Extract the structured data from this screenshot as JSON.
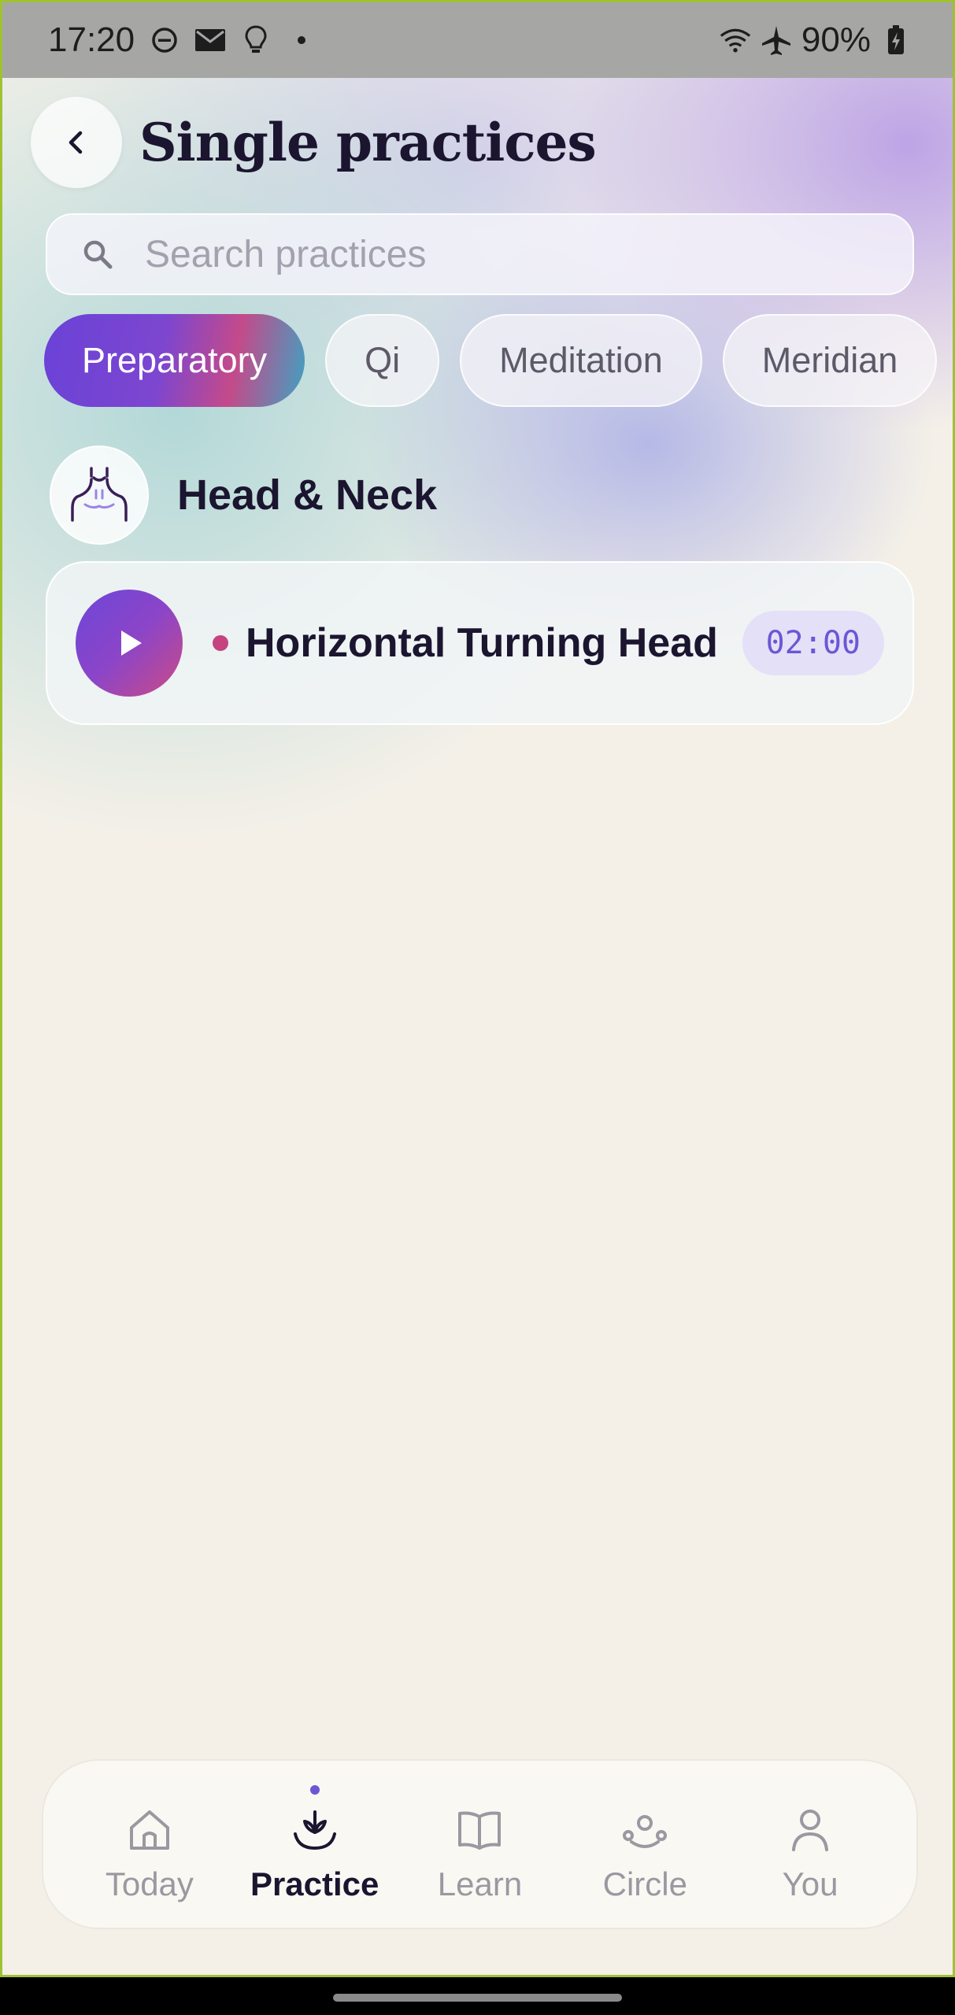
{
  "status_bar": {
    "time": "17:20",
    "battery": "90%",
    "left_icons": [
      "do-not-disturb-icon",
      "mail-icon",
      "lightbulb-icon",
      "dot-icon"
    ],
    "right_icons": [
      "wifi-icon",
      "airplane-icon",
      "battery-charging-icon"
    ]
  },
  "header": {
    "title": "Single practices",
    "back_icon": "chevron-left-icon"
  },
  "search": {
    "placeholder": "Search practices",
    "value": ""
  },
  "filters": [
    {
      "label": "Preparatory",
      "active": true
    },
    {
      "label": "Qi",
      "active": false
    },
    {
      "label": "Meditation",
      "active": false
    },
    {
      "label": "Meridian",
      "active": false
    }
  ],
  "section": {
    "title": "Head & Neck",
    "icon": "neck-body-icon"
  },
  "practices": [
    {
      "name": "Horizontal Turning Head",
      "duration": "02:00"
    }
  ],
  "bottom_nav": {
    "items": [
      {
        "label": "Today",
        "icon": "home-icon",
        "active": false
      },
      {
        "label": "Practice",
        "icon": "lotus-icon",
        "active": true
      },
      {
        "label": "Learn",
        "icon": "book-icon",
        "active": false
      },
      {
        "label": "Circle",
        "icon": "people-icon",
        "active": false
      },
      {
        "label": "You",
        "icon": "user-icon",
        "active": false
      }
    ]
  },
  "colors": {
    "accent": "#6b57d6",
    "active_chip_gradient": [
      "#6a42d8",
      "#c44a8a",
      "#3fa2c2"
    ],
    "dot": "#c5447f",
    "text": "#1b1530"
  }
}
